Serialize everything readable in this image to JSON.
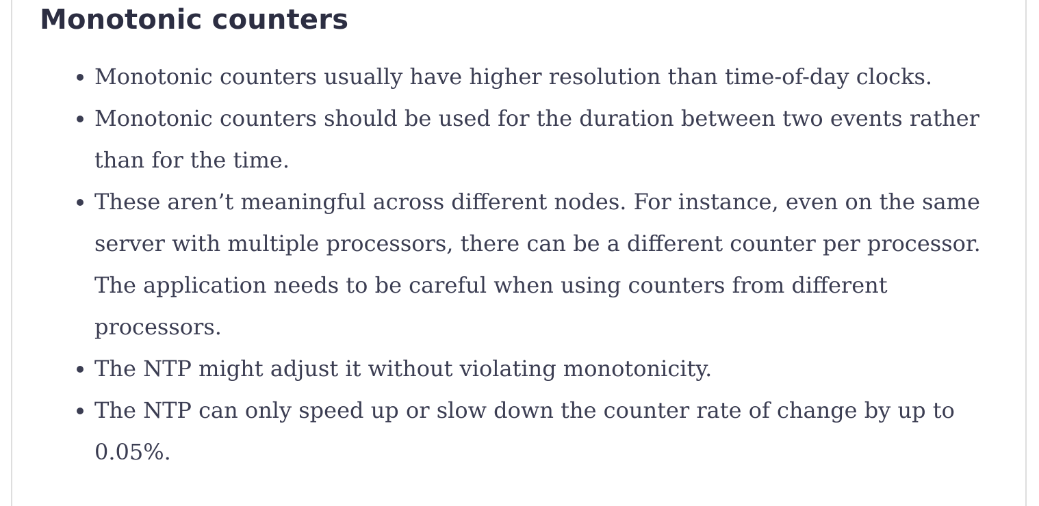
{
  "section": {
    "heading": "Monotonic counters",
    "bullets": [
      "Monotonic counters usually have higher resolution than time-of-day clocks.",
      "Monotonic counters should be used for the duration between two events rather than for the time.",
      "These aren’t meaningful across different nodes. For instance, even on the same server with multiple processors, there can be a different counter per processor. The application needs to be careful when using counters from different processors.",
      "The NTP might adjust it without violating monotonicity.",
      "The NTP can only speed up or slow down the counter rate of change by up to 0.05%."
    ]
  }
}
